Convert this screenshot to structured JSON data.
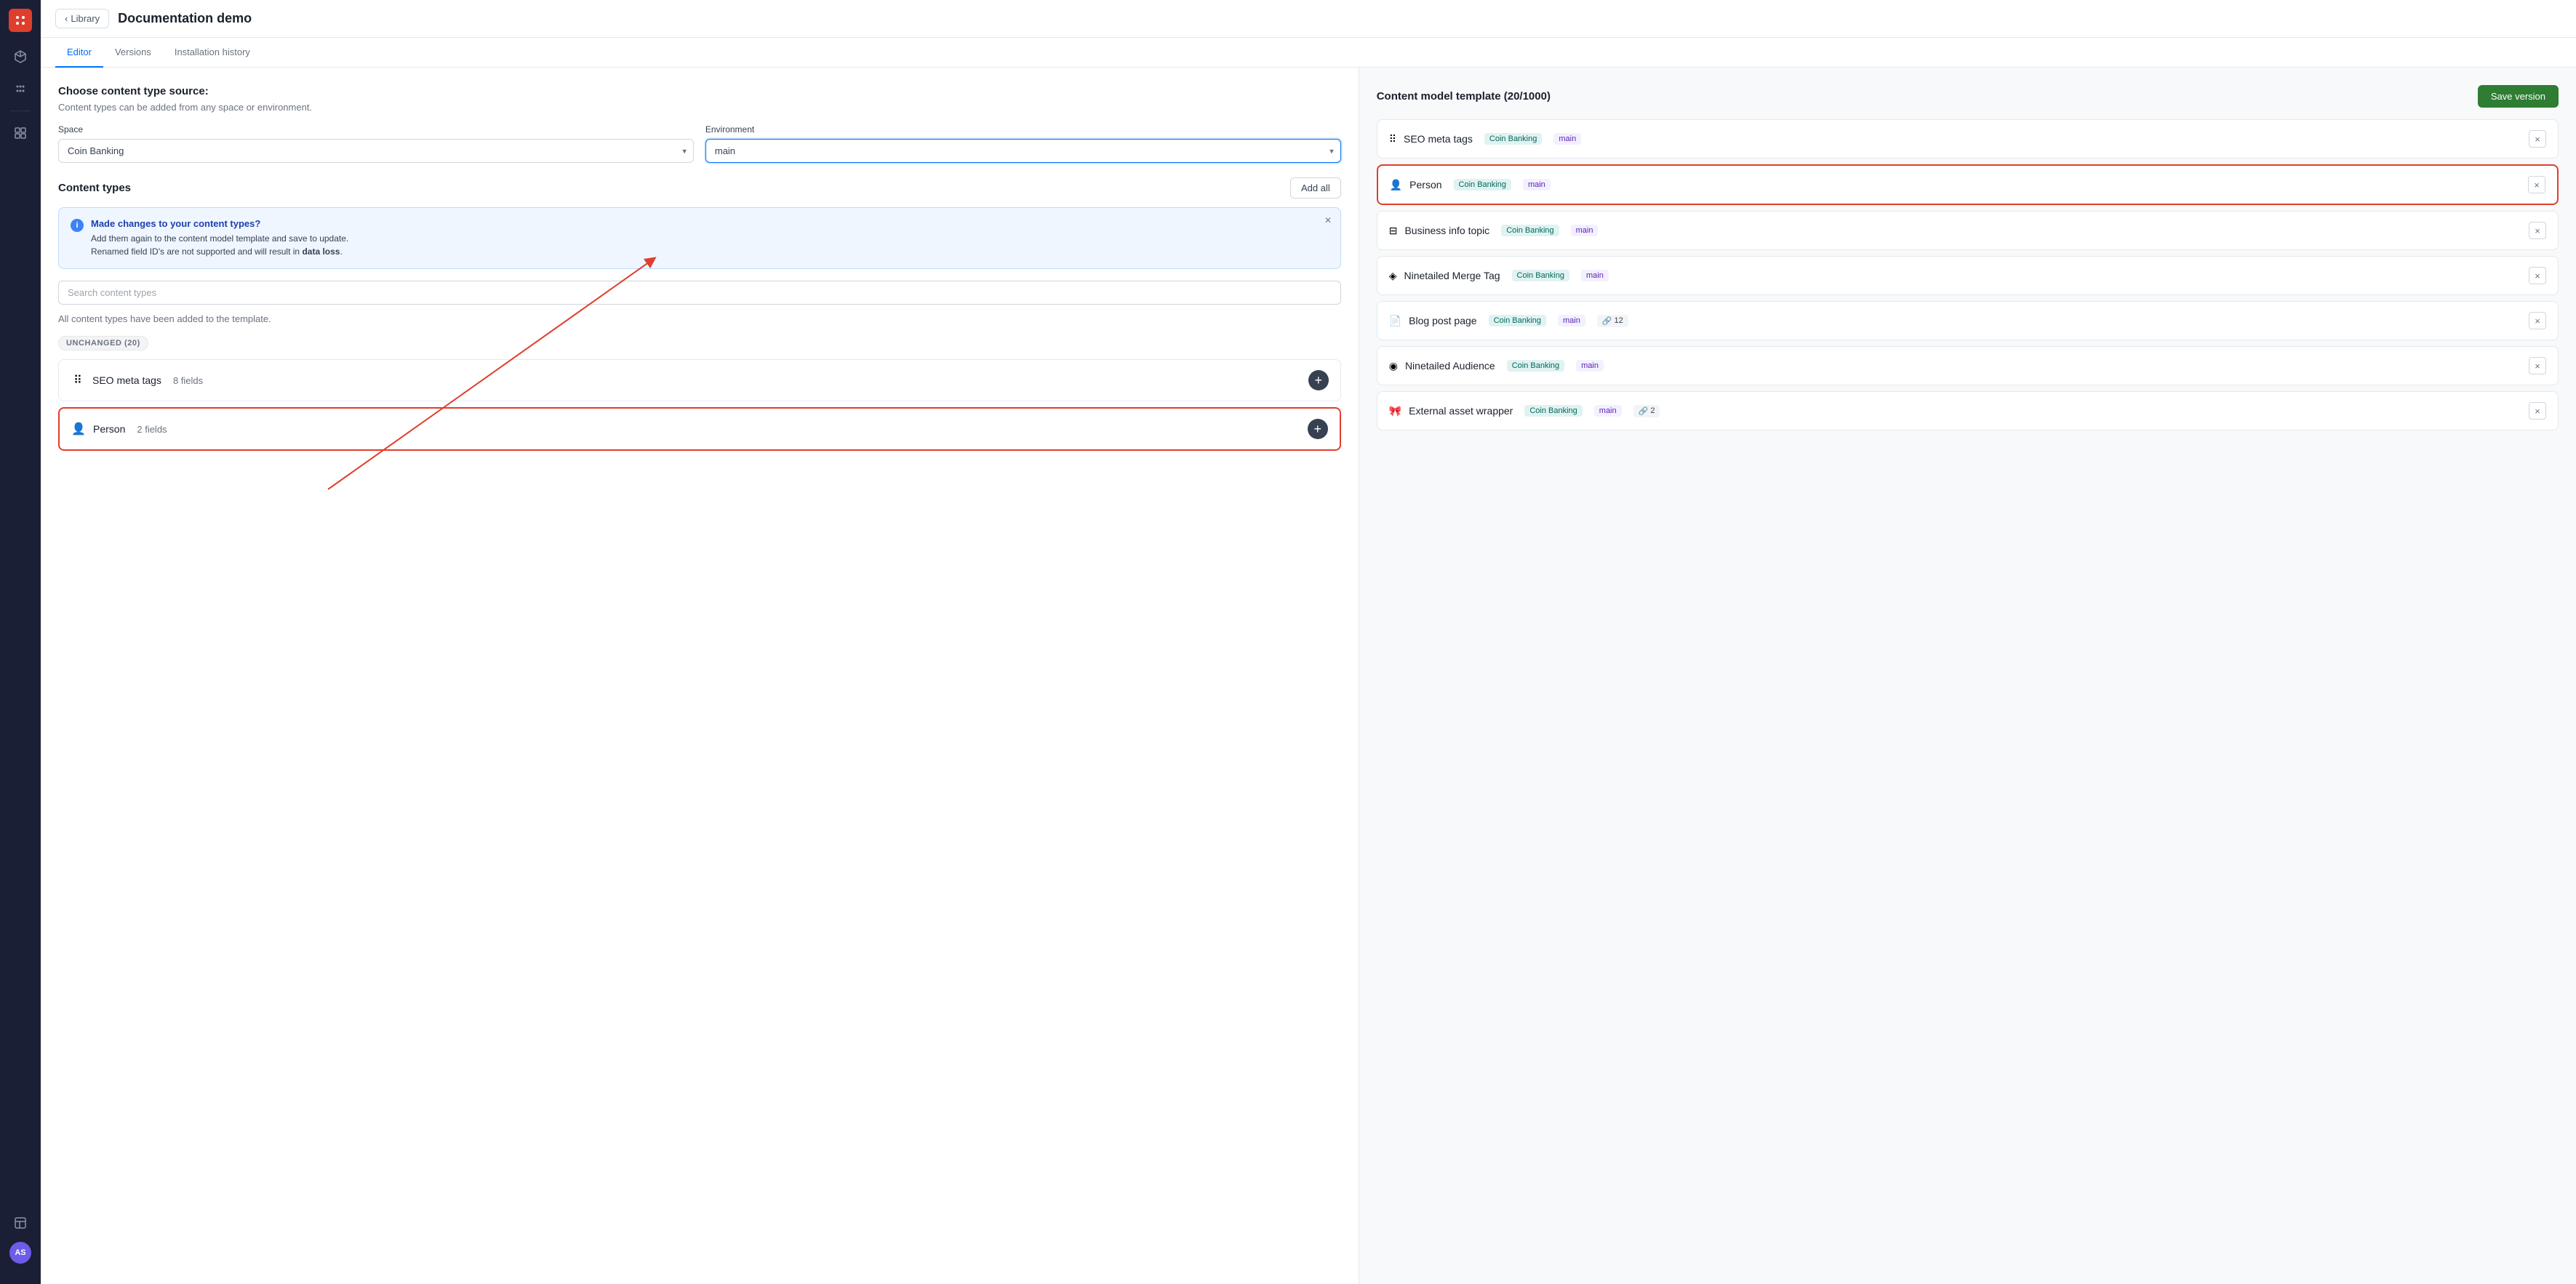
{
  "sidebar": {
    "logo_text": "●",
    "avatar": "AS",
    "icons": [
      {
        "name": "grid-icon",
        "symbol": "⊞"
      },
      {
        "name": "cube-icon",
        "symbol": "⬡"
      },
      {
        "name": "dots-icon",
        "symbol": "⠿"
      },
      {
        "name": "apps-icon",
        "symbol": "⊞"
      },
      {
        "name": "layers-icon",
        "symbol": "≡"
      },
      {
        "name": "panel-icon",
        "symbol": "▣"
      }
    ]
  },
  "topbar": {
    "library_btn": "Library",
    "page_title": "Documentation demo"
  },
  "tabs": [
    {
      "label": "Editor",
      "active": true
    },
    {
      "label": "Versions",
      "active": false
    },
    {
      "label": "Installation history",
      "active": false
    }
  ],
  "left_panel": {
    "section_title": "Choose content type source:",
    "section_desc": "Content types can be added from any space or environment.",
    "space_label": "Space",
    "space_value": "Coin Banking",
    "environment_label": "Environment",
    "environment_value": "main",
    "content_types_title": "Content types",
    "add_all_btn": "Add all",
    "info_banner": {
      "title": "Made changes to your content types?",
      "line1": "Add them again to the content model template and save to update.",
      "line2_prefix": "Renamed field ID's are not supported and will result in ",
      "line2_bold": "data loss",
      "line2_suffix": "."
    },
    "search_placeholder": "Search content types",
    "all_added_text": "All content types have been added to the template.",
    "badge_unchanged": "UNCHANGED (20)",
    "content_types": [
      {
        "icon": "⠿",
        "name": "SEO meta tags",
        "fields": "8 fields",
        "highlighted": false
      },
      {
        "icon": "",
        "name": "Person",
        "fields": "2 fields",
        "highlighted": true
      }
    ]
  },
  "right_panel": {
    "title": "Content model template (20/1000)",
    "save_btn": "Save version",
    "items": [
      {
        "icon": "⠿",
        "name": "SEO meta tags",
        "space": "Coin Banking",
        "env": "main",
        "link_count": null,
        "highlighted": false
      },
      {
        "icon": "",
        "name": "Person",
        "space": "Coin Banking",
        "env": "main",
        "link_count": null,
        "highlighted": true
      },
      {
        "icon": "⊟",
        "name": "Business info topic",
        "space": "Coin Banking",
        "env": "main",
        "link_count": null,
        "highlighted": false
      },
      {
        "icon": "",
        "name": "Ninetailed Merge Tag",
        "space": "Coin Banking",
        "env": "main",
        "link_count": null,
        "highlighted": false
      },
      {
        "icon": "📄",
        "name": "Blog post page",
        "space": "Coin Banking",
        "env": "main",
        "link_count": "12",
        "highlighted": false
      },
      {
        "icon": "",
        "name": "Ninetailed Audience",
        "space": "Coin Banking",
        "env": "main",
        "link_count": null,
        "highlighted": false
      },
      {
        "icon": "🎀",
        "name": "External asset wrapper",
        "space": "Coin Banking",
        "env": "main",
        "link_count": "2",
        "highlighted": false
      }
    ]
  }
}
